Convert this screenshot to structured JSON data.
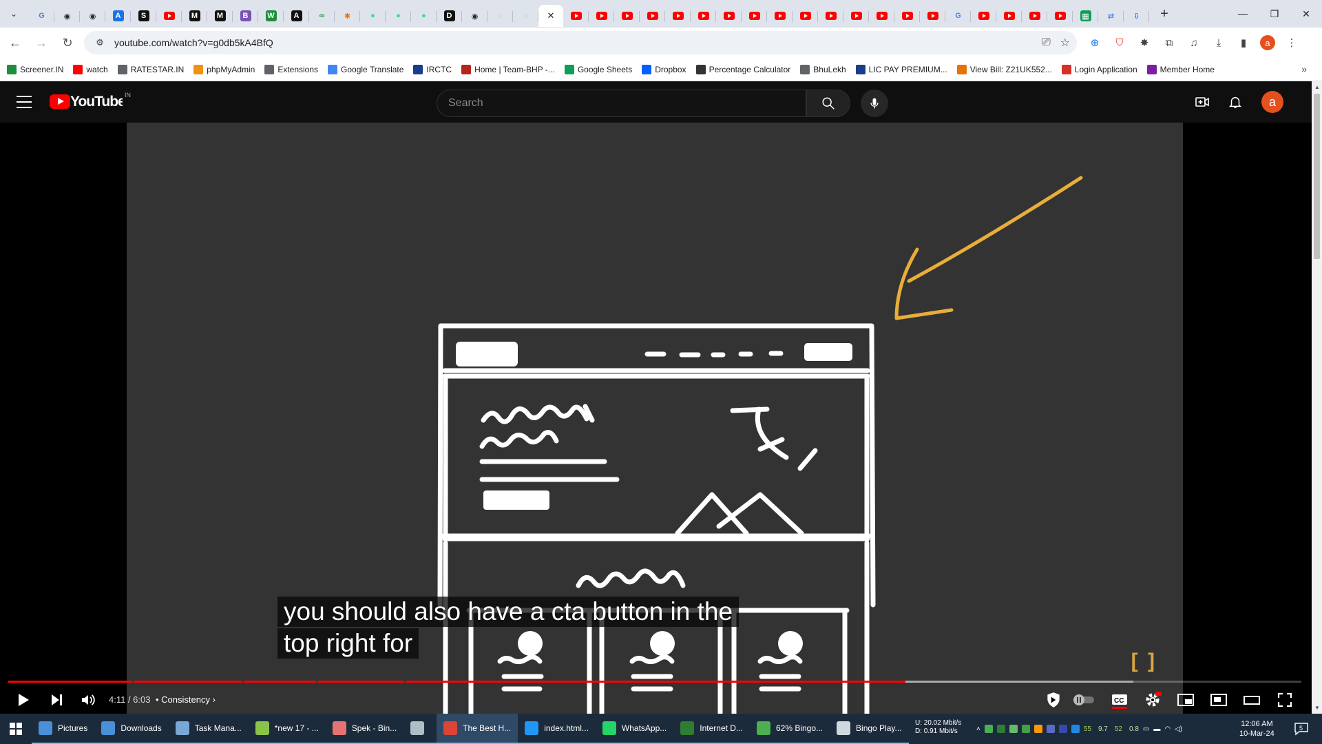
{
  "browser": {
    "tabs": [
      {
        "icon": "google-g",
        "color": "#4285f4",
        "glyph": "G"
      },
      {
        "icon": "github",
        "color": "#24292f",
        "glyph": "◉"
      },
      {
        "icon": "github",
        "color": "#24292f",
        "glyph": "◉"
      },
      {
        "icon": "astro",
        "color": "#1a73e8",
        "glyph": "A"
      },
      {
        "icon": "s",
        "color": "#111111",
        "glyph": "S"
      },
      {
        "icon": "youtube",
        "color": "#ff0000",
        "glyph": ""
      },
      {
        "icon": "medium",
        "color": "#111111",
        "glyph": "M"
      },
      {
        "icon": "medium",
        "color": "#111111",
        "glyph": "M"
      },
      {
        "icon": "bootstrap",
        "color": "#7952b3",
        "glyph": "B"
      },
      {
        "icon": "w",
        "color": "#1e8e3e",
        "glyph": "W"
      },
      {
        "icon": "a",
        "color": "#111111",
        "glyph": "A"
      },
      {
        "icon": "chain",
        "color": "#1e8e3e",
        "glyph": "∞"
      },
      {
        "icon": "asterisk",
        "color": "#e8710a",
        "glyph": "✱"
      },
      {
        "icon": "android",
        "color": "#3ddc84",
        "glyph": "●"
      },
      {
        "icon": "android",
        "color": "#3ddc84",
        "glyph": "●"
      },
      {
        "icon": "android",
        "color": "#3ddc84",
        "glyph": "●"
      },
      {
        "icon": "dev",
        "color": "#111111",
        "glyph": "D"
      },
      {
        "icon": "github",
        "color": "#24292f",
        "glyph": "◉"
      },
      {
        "icon": "loading",
        "color": "#8ab4f8",
        "glyph": "◌"
      },
      {
        "icon": "loading",
        "color": "#8ab4f8",
        "glyph": "◌"
      },
      {
        "icon": "active-close",
        "color": "#222222",
        "glyph": "✕",
        "active": true
      },
      {
        "icon": "youtube",
        "color": "#ff0000",
        "glyph": ""
      },
      {
        "icon": "youtube",
        "color": "#ff0000",
        "glyph": ""
      },
      {
        "icon": "youtube",
        "color": "#ff0000",
        "glyph": ""
      },
      {
        "icon": "youtube",
        "color": "#ff0000",
        "glyph": ""
      },
      {
        "icon": "youtube",
        "color": "#ff0000",
        "glyph": ""
      },
      {
        "icon": "youtube",
        "color": "#ff0000",
        "glyph": ""
      },
      {
        "icon": "youtube",
        "color": "#ff0000",
        "glyph": ""
      },
      {
        "icon": "youtube",
        "color": "#ff0000",
        "glyph": ""
      },
      {
        "icon": "youtube",
        "color": "#ff0000",
        "glyph": ""
      },
      {
        "icon": "youtube",
        "color": "#ff0000",
        "glyph": ""
      },
      {
        "icon": "youtube",
        "color": "#ff0000",
        "glyph": ""
      },
      {
        "icon": "youtube",
        "color": "#ff0000",
        "glyph": ""
      },
      {
        "icon": "youtube",
        "color": "#ff0000",
        "glyph": ""
      },
      {
        "icon": "youtube",
        "color": "#ff0000",
        "glyph": ""
      },
      {
        "icon": "youtube",
        "color": "#ff0000",
        "glyph": ""
      },
      {
        "icon": "google-g",
        "color": "#4285f4",
        "glyph": "G"
      },
      {
        "icon": "youtube",
        "color": "#ff0000",
        "glyph": ""
      },
      {
        "icon": "youtube",
        "color": "#ff0000",
        "glyph": ""
      },
      {
        "icon": "youtube",
        "color": "#ff0000",
        "glyph": ""
      },
      {
        "icon": "youtube",
        "color": "#ff0000",
        "glyph": ""
      },
      {
        "icon": "sheets",
        "color": "#0f9d58",
        "glyph": "▦"
      },
      {
        "icon": "translate",
        "color": "#4285f4",
        "glyph": "⇄"
      },
      {
        "icon": "download",
        "color": "#1a73e8",
        "glyph": "⇩"
      }
    ],
    "url": "youtube.com/watch?v=g0db5kA4BfQ",
    "bookmarks": [
      {
        "label": "Screener.IN",
        "color": "#1e8e3e"
      },
      {
        "label": "watch",
        "color": "#ff0000"
      },
      {
        "label": "RATESTAR.IN",
        "color": "#5f6368"
      },
      {
        "label": "phpMyAdmin",
        "color": "#f29111"
      },
      {
        "label": "Extensions",
        "color": "#5f6368"
      },
      {
        "label": "Google Translate",
        "color": "#4285f4"
      },
      {
        "label": "IRCTC",
        "color": "#1a3c8f"
      },
      {
        "label": "Home | Team-BHP -...",
        "color": "#b3261e"
      },
      {
        "label": "Google Sheets",
        "color": "#0f9d58"
      },
      {
        "label": "Dropbox",
        "color": "#0061fe"
      },
      {
        "label": "Percentage Calculator",
        "color": "#333333"
      },
      {
        "label": "BhuLekh",
        "color": "#5f6368"
      },
      {
        "label": "LIC PAY PREMIUM...",
        "color": "#1a3c8f"
      },
      {
        "label": "View Bill: Z21UK552...",
        "color": "#e8710a"
      },
      {
        "label": "Login Application",
        "color": "#d93025"
      },
      {
        "label": "Member Home",
        "color": "#7b1fa2"
      }
    ]
  },
  "youtube": {
    "region": "IN",
    "search_placeholder": "Search",
    "avatar_letter": "a",
    "player": {
      "caption_line1": "you should also have a cta button in the",
      "caption_line2": "top right for",
      "chapter_bracket": "[ ]",
      "time": "4:11 / 6:03",
      "chapter": "Consistency",
      "progress_fraction": 0.694,
      "buffer_fraction": 0.87,
      "chapter_marks": [
        0.096,
        0.181,
        0.238,
        0.306
      ]
    }
  },
  "taskbar": {
    "items": [
      {
        "label": "Pictures",
        "color": "#4a90d9",
        "state": "open"
      },
      {
        "label": "Downloads",
        "color": "#4a90d9",
        "state": "open"
      },
      {
        "label": "Task Mana...",
        "color": "#7aa7d6",
        "state": "open"
      },
      {
        "label": "*new 17 - ...",
        "color": "#8bc34a",
        "state": "open"
      },
      {
        "label": "Spek - Bin...",
        "color": "#e57373",
        "state": "open"
      },
      {
        "label": "",
        "color": "#b0bec5",
        "state": "open"
      },
      {
        "label": "The Best H...",
        "color": "#db4437",
        "state": "active"
      },
      {
        "label": "index.html...",
        "color": "#2196f3",
        "state": "open"
      },
      {
        "label": "WhatsApp...",
        "color": "#25d366",
        "state": "open"
      },
      {
        "label": "Internet D...",
        "color": "#2e7d32",
        "state": "open"
      },
      {
        "label": "62% Bingo...",
        "color": "#4caf50",
        "state": "open"
      },
      {
        "label": "Bingo Play...",
        "color": "#cfd8dc",
        "state": "open"
      }
    ],
    "net_up": "U:   20.02 Mbit/s",
    "net_down": "D:    0.91 Mbit/s",
    "tray_values": [
      "55",
      "9.7",
      "52",
      "0.8"
    ],
    "time": "12:06 AM",
    "date": "10-Mar-24",
    "notification_count": "5"
  }
}
